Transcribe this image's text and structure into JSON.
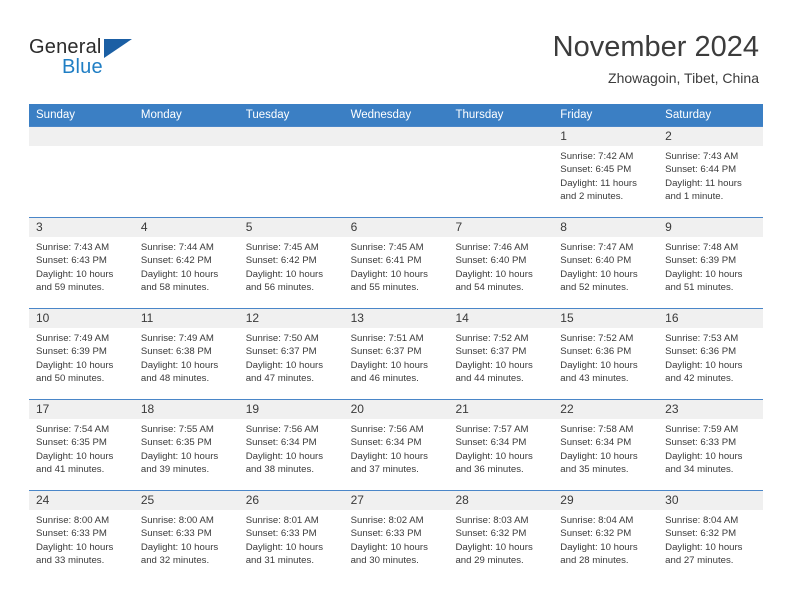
{
  "logo": {
    "text_primary": "General",
    "text_secondary": "Blue",
    "triangle_icon": "blue-triangle-icon"
  },
  "header": {
    "title": "November 2024",
    "location": "Zhowagoin, Tibet, China"
  },
  "colors": {
    "header_blue": "#3b7fc4",
    "divider_blue": "#4a86c8",
    "daynum_band": "#f0f0f0",
    "logo_blue": "#1f7ec4",
    "text": "#3a3a3a"
  },
  "weekdays": [
    "Sunday",
    "Monday",
    "Tuesday",
    "Wednesday",
    "Thursday",
    "Friday",
    "Saturday"
  ],
  "weeks": [
    {
      "days": [
        {
          "day": "",
          "sunrise": "",
          "sunset": "",
          "daylight_line1": "",
          "daylight_line2": ""
        },
        {
          "day": "",
          "sunrise": "",
          "sunset": "",
          "daylight_line1": "",
          "daylight_line2": ""
        },
        {
          "day": "",
          "sunrise": "",
          "sunset": "",
          "daylight_line1": "",
          "daylight_line2": ""
        },
        {
          "day": "",
          "sunrise": "",
          "sunset": "",
          "daylight_line1": "",
          "daylight_line2": ""
        },
        {
          "day": "",
          "sunrise": "",
          "sunset": "",
          "daylight_line1": "",
          "daylight_line2": ""
        },
        {
          "day": "1",
          "sunrise": "Sunrise: 7:42 AM",
          "sunset": "Sunset: 6:45 PM",
          "daylight_line1": "Daylight: 11 hours",
          "daylight_line2": "and 2 minutes."
        },
        {
          "day": "2",
          "sunrise": "Sunrise: 7:43 AM",
          "sunset": "Sunset: 6:44 PM",
          "daylight_line1": "Daylight: 11 hours",
          "daylight_line2": "and 1 minute."
        }
      ]
    },
    {
      "days": [
        {
          "day": "3",
          "sunrise": "Sunrise: 7:43 AM",
          "sunset": "Sunset: 6:43 PM",
          "daylight_line1": "Daylight: 10 hours",
          "daylight_line2": "and 59 minutes."
        },
        {
          "day": "4",
          "sunrise": "Sunrise: 7:44 AM",
          "sunset": "Sunset: 6:42 PM",
          "daylight_line1": "Daylight: 10 hours",
          "daylight_line2": "and 58 minutes."
        },
        {
          "day": "5",
          "sunrise": "Sunrise: 7:45 AM",
          "sunset": "Sunset: 6:42 PM",
          "daylight_line1": "Daylight: 10 hours",
          "daylight_line2": "and 56 minutes."
        },
        {
          "day": "6",
          "sunrise": "Sunrise: 7:45 AM",
          "sunset": "Sunset: 6:41 PM",
          "daylight_line1": "Daylight: 10 hours",
          "daylight_line2": "and 55 minutes."
        },
        {
          "day": "7",
          "sunrise": "Sunrise: 7:46 AM",
          "sunset": "Sunset: 6:40 PM",
          "daylight_line1": "Daylight: 10 hours",
          "daylight_line2": "and 54 minutes."
        },
        {
          "day": "8",
          "sunrise": "Sunrise: 7:47 AM",
          "sunset": "Sunset: 6:40 PM",
          "daylight_line1": "Daylight: 10 hours",
          "daylight_line2": "and 52 minutes."
        },
        {
          "day": "9",
          "sunrise": "Sunrise: 7:48 AM",
          "sunset": "Sunset: 6:39 PM",
          "daylight_line1": "Daylight: 10 hours",
          "daylight_line2": "and 51 minutes."
        }
      ]
    },
    {
      "days": [
        {
          "day": "10",
          "sunrise": "Sunrise: 7:49 AM",
          "sunset": "Sunset: 6:39 PM",
          "daylight_line1": "Daylight: 10 hours",
          "daylight_line2": "and 50 minutes."
        },
        {
          "day": "11",
          "sunrise": "Sunrise: 7:49 AM",
          "sunset": "Sunset: 6:38 PM",
          "daylight_line1": "Daylight: 10 hours",
          "daylight_line2": "and 48 minutes."
        },
        {
          "day": "12",
          "sunrise": "Sunrise: 7:50 AM",
          "sunset": "Sunset: 6:37 PM",
          "daylight_line1": "Daylight: 10 hours",
          "daylight_line2": "and 47 minutes."
        },
        {
          "day": "13",
          "sunrise": "Sunrise: 7:51 AM",
          "sunset": "Sunset: 6:37 PM",
          "daylight_line1": "Daylight: 10 hours",
          "daylight_line2": "and 46 minutes."
        },
        {
          "day": "14",
          "sunrise": "Sunrise: 7:52 AM",
          "sunset": "Sunset: 6:37 PM",
          "daylight_line1": "Daylight: 10 hours",
          "daylight_line2": "and 44 minutes."
        },
        {
          "day": "15",
          "sunrise": "Sunrise: 7:52 AM",
          "sunset": "Sunset: 6:36 PM",
          "daylight_line1": "Daylight: 10 hours",
          "daylight_line2": "and 43 minutes."
        },
        {
          "day": "16",
          "sunrise": "Sunrise: 7:53 AM",
          "sunset": "Sunset: 6:36 PM",
          "daylight_line1": "Daylight: 10 hours",
          "daylight_line2": "and 42 minutes."
        }
      ]
    },
    {
      "days": [
        {
          "day": "17",
          "sunrise": "Sunrise: 7:54 AM",
          "sunset": "Sunset: 6:35 PM",
          "daylight_line1": "Daylight: 10 hours",
          "daylight_line2": "and 41 minutes."
        },
        {
          "day": "18",
          "sunrise": "Sunrise: 7:55 AM",
          "sunset": "Sunset: 6:35 PM",
          "daylight_line1": "Daylight: 10 hours",
          "daylight_line2": "and 39 minutes."
        },
        {
          "day": "19",
          "sunrise": "Sunrise: 7:56 AM",
          "sunset": "Sunset: 6:34 PM",
          "daylight_line1": "Daylight: 10 hours",
          "daylight_line2": "and 38 minutes."
        },
        {
          "day": "20",
          "sunrise": "Sunrise: 7:56 AM",
          "sunset": "Sunset: 6:34 PM",
          "daylight_line1": "Daylight: 10 hours",
          "daylight_line2": "and 37 minutes."
        },
        {
          "day": "21",
          "sunrise": "Sunrise: 7:57 AM",
          "sunset": "Sunset: 6:34 PM",
          "daylight_line1": "Daylight: 10 hours",
          "daylight_line2": "and 36 minutes."
        },
        {
          "day": "22",
          "sunrise": "Sunrise: 7:58 AM",
          "sunset": "Sunset: 6:34 PM",
          "daylight_line1": "Daylight: 10 hours",
          "daylight_line2": "and 35 minutes."
        },
        {
          "day": "23",
          "sunrise": "Sunrise: 7:59 AM",
          "sunset": "Sunset: 6:33 PM",
          "daylight_line1": "Daylight: 10 hours",
          "daylight_line2": "and 34 minutes."
        }
      ]
    },
    {
      "days": [
        {
          "day": "24",
          "sunrise": "Sunrise: 8:00 AM",
          "sunset": "Sunset: 6:33 PM",
          "daylight_line1": "Daylight: 10 hours",
          "daylight_line2": "and 33 minutes."
        },
        {
          "day": "25",
          "sunrise": "Sunrise: 8:00 AM",
          "sunset": "Sunset: 6:33 PM",
          "daylight_line1": "Daylight: 10 hours",
          "daylight_line2": "and 32 minutes."
        },
        {
          "day": "26",
          "sunrise": "Sunrise: 8:01 AM",
          "sunset": "Sunset: 6:33 PM",
          "daylight_line1": "Daylight: 10 hours",
          "daylight_line2": "and 31 minutes."
        },
        {
          "day": "27",
          "sunrise": "Sunrise: 8:02 AM",
          "sunset": "Sunset: 6:33 PM",
          "daylight_line1": "Daylight: 10 hours",
          "daylight_line2": "and 30 minutes."
        },
        {
          "day": "28",
          "sunrise": "Sunrise: 8:03 AM",
          "sunset": "Sunset: 6:32 PM",
          "daylight_line1": "Daylight: 10 hours",
          "daylight_line2": "and 29 minutes."
        },
        {
          "day": "29",
          "sunrise": "Sunrise: 8:04 AM",
          "sunset": "Sunset: 6:32 PM",
          "daylight_line1": "Daylight: 10 hours",
          "daylight_line2": "and 28 minutes."
        },
        {
          "day": "30",
          "sunrise": "Sunrise: 8:04 AM",
          "sunset": "Sunset: 6:32 PM",
          "daylight_line1": "Daylight: 10 hours",
          "daylight_line2": "and 27 minutes."
        }
      ]
    }
  ]
}
